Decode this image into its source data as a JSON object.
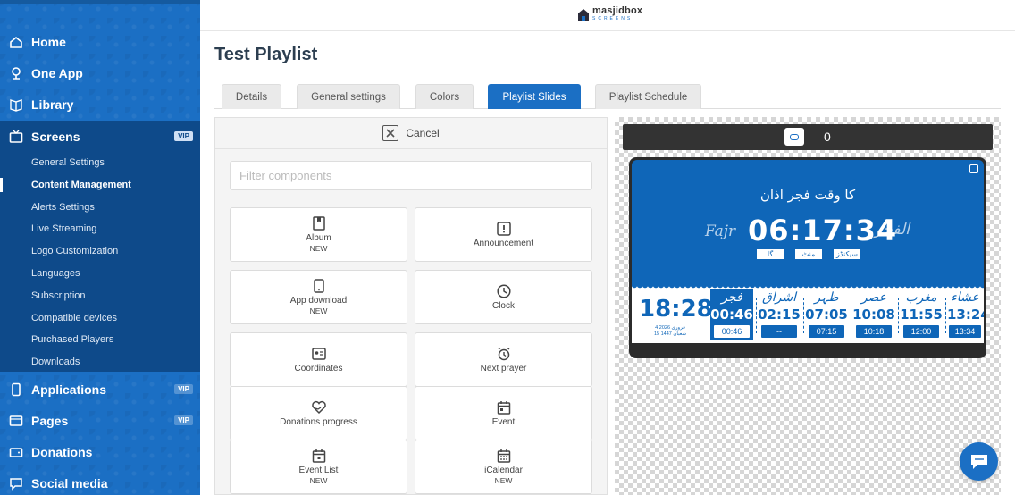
{
  "sidebar": {
    "nav": [
      {
        "label": "Home",
        "icon": "home-icon"
      },
      {
        "label": "One App",
        "icon": "mosque-icon"
      },
      {
        "label": "Library",
        "icon": "library-icon"
      },
      {
        "label": "Screens",
        "icon": "tv-icon",
        "badge": "VIP",
        "active": true
      },
      {
        "label": "Applications",
        "icon": "phone-icon",
        "badge": "VIP"
      },
      {
        "label": "Pages",
        "icon": "pages-icon",
        "badge": "VIP"
      },
      {
        "label": "Donations",
        "icon": "wallet-icon"
      },
      {
        "label": "Social media",
        "icon": "chat-icon"
      }
    ],
    "sub_items": [
      "General Settings",
      "Content Management",
      "Alerts Settings",
      "Live Streaming",
      "Logo Customization",
      "Languages",
      "Subscription",
      "Compatible devices",
      "Purchased Players",
      "Downloads"
    ],
    "active_sub": "Content Management"
  },
  "header": {
    "logo_name": "masjidbox",
    "logo_sub": "SCREENS"
  },
  "page": {
    "title": "Test Playlist"
  },
  "tabs": [
    "Details",
    "General settings",
    "Colors",
    "Playlist Slides",
    "Playlist Schedule"
  ],
  "active_tab": "Playlist Slides",
  "panel": {
    "cancel_label": "Cancel",
    "filter_placeholder": "Filter components",
    "filter_value": "",
    "components": [
      {
        "label": "Album",
        "new": "NEW",
        "icon": "album-icon"
      },
      {
        "label": "Announcement",
        "new": "",
        "icon": "announcement-icon"
      },
      {
        "label": "App download",
        "new": "NEW",
        "icon": "phone-download-icon"
      },
      {
        "label": "Clock",
        "new": "",
        "icon": "clock-icon"
      },
      {
        "label": "Coordinates",
        "new": "",
        "icon": "coordinates-icon"
      },
      {
        "label": "Next prayer",
        "new": "",
        "icon": "alarm-clock-icon"
      },
      {
        "label": "Donations progress",
        "new": "",
        "icon": "heart-hand-icon"
      },
      {
        "label": "Event",
        "new": "",
        "icon": "calendar-icon"
      },
      {
        "label": "Event List",
        "new": "NEW",
        "icon": "calendar-list-icon"
      },
      {
        "label": "iCalendar",
        "new": "NEW",
        "icon": "icalendar-icon"
      }
    ]
  },
  "preview": {
    "slide_count": "0",
    "screen": {
      "title": "کا وقت فجر اذان",
      "countdown": "06:17:34",
      "units": [
        "گا",
        "منٹ",
        "سیکنڈز"
      ],
      "left_callig": "Fajr",
      "right_callig": "الفجر",
      "current_time": "18:28",
      "date_line1": "4 فروری 2026",
      "date_line2": "15 شعبان 1447",
      "prayers": [
        {
          "name": "فجر",
          "time": "00:46",
          "iqama": "00:46",
          "active": true
        },
        {
          "name": "اشراق",
          "time": "02:15",
          "iqama": "--",
          "active": false
        },
        {
          "name": "ظہر",
          "time": "07:05",
          "iqama": "07:15",
          "active": false
        },
        {
          "name": "عصر",
          "time": "10:08",
          "iqama": "10:18",
          "active": false
        },
        {
          "name": "مغرب",
          "time": "11:55",
          "iqama": "12:00",
          "active": false
        },
        {
          "name": "عشاء",
          "time": "13:24",
          "iqama": "13:34",
          "active": false
        }
      ]
    }
  },
  "colors": {
    "brand_blue": "#1b6fc4",
    "sidebar_active": "#0e4a8a",
    "screen_blue": "#0f66b8"
  }
}
